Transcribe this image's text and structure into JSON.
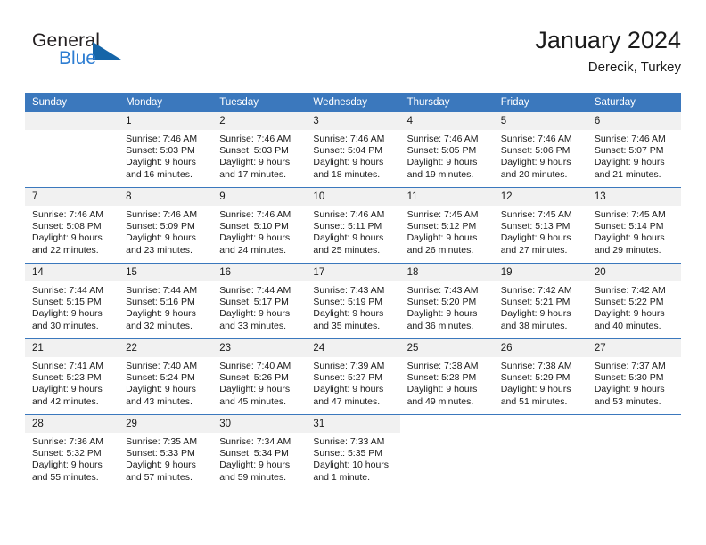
{
  "brand": {
    "name_part1": "General",
    "name_part2": "Blue",
    "triangle_color": "#1565a8",
    "blue_color": "#2d7dd2"
  },
  "header": {
    "title": "January 2024",
    "subtitle": "Derecik, Turkey",
    "header_bg": "#3b78bd",
    "daynum_bg": "#f1f1f1"
  },
  "calendar": {
    "weekday_headers": [
      "Sunday",
      "Monday",
      "Tuesday",
      "Wednesday",
      "Thursday",
      "Friday",
      "Saturday"
    ],
    "weeks": [
      [
        {
          "day": "",
          "empty": true
        },
        {
          "day": "1",
          "sunrise": "Sunrise: 7:46 AM",
          "sunset": "Sunset: 5:03 PM",
          "daylight1": "Daylight: 9 hours",
          "daylight2": "and 16 minutes."
        },
        {
          "day": "2",
          "sunrise": "Sunrise: 7:46 AM",
          "sunset": "Sunset: 5:03 PM",
          "daylight1": "Daylight: 9 hours",
          "daylight2": "and 17 minutes."
        },
        {
          "day": "3",
          "sunrise": "Sunrise: 7:46 AM",
          "sunset": "Sunset: 5:04 PM",
          "daylight1": "Daylight: 9 hours",
          "daylight2": "and 18 minutes."
        },
        {
          "day": "4",
          "sunrise": "Sunrise: 7:46 AM",
          "sunset": "Sunset: 5:05 PM",
          "daylight1": "Daylight: 9 hours",
          "daylight2": "and 19 minutes."
        },
        {
          "day": "5",
          "sunrise": "Sunrise: 7:46 AM",
          "sunset": "Sunset: 5:06 PM",
          "daylight1": "Daylight: 9 hours",
          "daylight2": "and 20 minutes."
        },
        {
          "day": "6",
          "sunrise": "Sunrise: 7:46 AM",
          "sunset": "Sunset: 5:07 PM",
          "daylight1": "Daylight: 9 hours",
          "daylight2": "and 21 minutes."
        }
      ],
      [
        {
          "day": "7",
          "sunrise": "Sunrise: 7:46 AM",
          "sunset": "Sunset: 5:08 PM",
          "daylight1": "Daylight: 9 hours",
          "daylight2": "and 22 minutes."
        },
        {
          "day": "8",
          "sunrise": "Sunrise: 7:46 AM",
          "sunset": "Sunset: 5:09 PM",
          "daylight1": "Daylight: 9 hours",
          "daylight2": "and 23 minutes."
        },
        {
          "day": "9",
          "sunrise": "Sunrise: 7:46 AM",
          "sunset": "Sunset: 5:10 PM",
          "daylight1": "Daylight: 9 hours",
          "daylight2": "and 24 minutes."
        },
        {
          "day": "10",
          "sunrise": "Sunrise: 7:46 AM",
          "sunset": "Sunset: 5:11 PM",
          "daylight1": "Daylight: 9 hours",
          "daylight2": "and 25 minutes."
        },
        {
          "day": "11",
          "sunrise": "Sunrise: 7:45 AM",
          "sunset": "Sunset: 5:12 PM",
          "daylight1": "Daylight: 9 hours",
          "daylight2": "and 26 minutes."
        },
        {
          "day": "12",
          "sunrise": "Sunrise: 7:45 AM",
          "sunset": "Sunset: 5:13 PM",
          "daylight1": "Daylight: 9 hours",
          "daylight2": "and 27 minutes."
        },
        {
          "day": "13",
          "sunrise": "Sunrise: 7:45 AM",
          "sunset": "Sunset: 5:14 PM",
          "daylight1": "Daylight: 9 hours",
          "daylight2": "and 29 minutes."
        }
      ],
      [
        {
          "day": "14",
          "sunrise": "Sunrise: 7:44 AM",
          "sunset": "Sunset: 5:15 PM",
          "daylight1": "Daylight: 9 hours",
          "daylight2": "and 30 minutes."
        },
        {
          "day": "15",
          "sunrise": "Sunrise: 7:44 AM",
          "sunset": "Sunset: 5:16 PM",
          "daylight1": "Daylight: 9 hours",
          "daylight2": "and 32 minutes."
        },
        {
          "day": "16",
          "sunrise": "Sunrise: 7:44 AM",
          "sunset": "Sunset: 5:17 PM",
          "daylight1": "Daylight: 9 hours",
          "daylight2": "and 33 minutes."
        },
        {
          "day": "17",
          "sunrise": "Sunrise: 7:43 AM",
          "sunset": "Sunset: 5:19 PM",
          "daylight1": "Daylight: 9 hours",
          "daylight2": "and 35 minutes."
        },
        {
          "day": "18",
          "sunrise": "Sunrise: 7:43 AM",
          "sunset": "Sunset: 5:20 PM",
          "daylight1": "Daylight: 9 hours",
          "daylight2": "and 36 minutes."
        },
        {
          "day": "19",
          "sunrise": "Sunrise: 7:42 AM",
          "sunset": "Sunset: 5:21 PM",
          "daylight1": "Daylight: 9 hours",
          "daylight2": "and 38 minutes."
        },
        {
          "day": "20",
          "sunrise": "Sunrise: 7:42 AM",
          "sunset": "Sunset: 5:22 PM",
          "daylight1": "Daylight: 9 hours",
          "daylight2": "and 40 minutes."
        }
      ],
      [
        {
          "day": "21",
          "sunrise": "Sunrise: 7:41 AM",
          "sunset": "Sunset: 5:23 PM",
          "daylight1": "Daylight: 9 hours",
          "daylight2": "and 42 minutes."
        },
        {
          "day": "22",
          "sunrise": "Sunrise: 7:40 AM",
          "sunset": "Sunset: 5:24 PM",
          "daylight1": "Daylight: 9 hours",
          "daylight2": "and 43 minutes."
        },
        {
          "day": "23",
          "sunrise": "Sunrise: 7:40 AM",
          "sunset": "Sunset: 5:26 PM",
          "daylight1": "Daylight: 9 hours",
          "daylight2": "and 45 minutes."
        },
        {
          "day": "24",
          "sunrise": "Sunrise: 7:39 AM",
          "sunset": "Sunset: 5:27 PM",
          "daylight1": "Daylight: 9 hours",
          "daylight2": "and 47 minutes."
        },
        {
          "day": "25",
          "sunrise": "Sunrise: 7:38 AM",
          "sunset": "Sunset: 5:28 PM",
          "daylight1": "Daylight: 9 hours",
          "daylight2": "and 49 minutes."
        },
        {
          "day": "26",
          "sunrise": "Sunrise: 7:38 AM",
          "sunset": "Sunset: 5:29 PM",
          "daylight1": "Daylight: 9 hours",
          "daylight2": "and 51 minutes."
        },
        {
          "day": "27",
          "sunrise": "Sunrise: 7:37 AM",
          "sunset": "Sunset: 5:30 PM",
          "daylight1": "Daylight: 9 hours",
          "daylight2": "and 53 minutes."
        }
      ],
      [
        {
          "day": "28",
          "sunrise": "Sunrise: 7:36 AM",
          "sunset": "Sunset: 5:32 PM",
          "daylight1": "Daylight: 9 hours",
          "daylight2": "and 55 minutes."
        },
        {
          "day": "29",
          "sunrise": "Sunrise: 7:35 AM",
          "sunset": "Sunset: 5:33 PM",
          "daylight1": "Daylight: 9 hours",
          "daylight2": "and 57 minutes."
        },
        {
          "day": "30",
          "sunrise": "Sunrise: 7:34 AM",
          "sunset": "Sunset: 5:34 PM",
          "daylight1": "Daylight: 9 hours",
          "daylight2": "and 59 minutes."
        },
        {
          "day": "31",
          "sunrise": "Sunrise: 7:33 AM",
          "sunset": "Sunset: 5:35 PM",
          "daylight1": "Daylight: 10 hours",
          "daylight2": "and 1 minute."
        },
        {
          "day": "",
          "blank": true
        },
        {
          "day": "",
          "blank": true
        },
        {
          "day": "",
          "blank": true
        }
      ]
    ]
  }
}
